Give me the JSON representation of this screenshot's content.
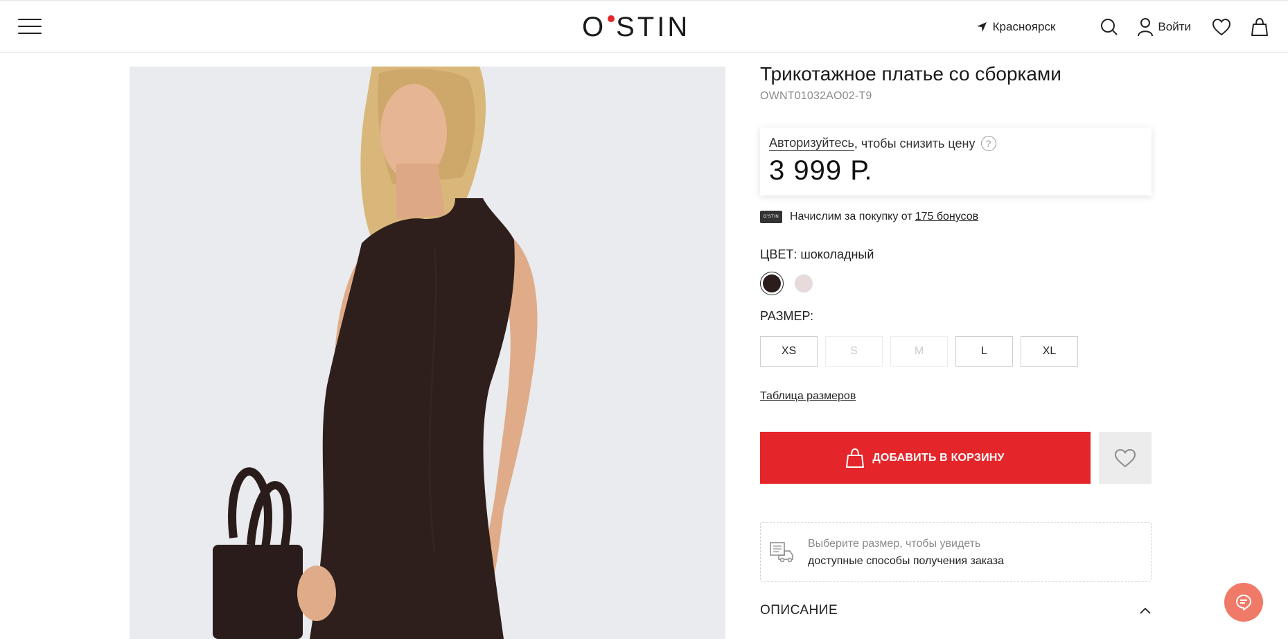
{
  "header": {
    "logo_text": "O'STIN",
    "logo_left": "O",
    "logo_right": "STIN",
    "city": "Красноярск",
    "login": "Войти",
    "icons": [
      "menu-icon",
      "location-arrow-icon",
      "search-icon",
      "user-icon",
      "heart-icon",
      "bag-icon"
    ]
  },
  "product": {
    "title": "Трикотажное платье со сборками",
    "sku": "OWNT01032AO02-T9",
    "price_box": {
      "auth_link": "Авторизуйтесь",
      "auth_suffix": ", чтобы снизить цену",
      "help": "?",
      "price": "3 999 Р."
    },
    "bonus": {
      "badge": "O'STIN",
      "text": "Начислим за покупку от",
      "link": "175 бонусов"
    },
    "color": {
      "label": "ЦВЕТ: шоколадный",
      "swatches": [
        {
          "name": "шоколадный",
          "hex": "#2b1d1c",
          "selected": true
        },
        {
          "name": "светло-розовый",
          "hex": "#e8dadb",
          "selected": false
        }
      ]
    },
    "size": {
      "label": "РАЗМЕР:",
      "options": [
        {
          "label": "XS",
          "available": true
        },
        {
          "label": "S",
          "available": false
        },
        {
          "label": "M",
          "available": false
        },
        {
          "label": "L",
          "available": true
        },
        {
          "label": "XL",
          "available": true
        }
      ],
      "table_link": "Таблица размеров"
    },
    "add_to_cart": "ДОБАВИТЬ В КОРЗИНУ",
    "delivery": {
      "line1": "Выберите размер, чтобы увидеть",
      "line2": "доступные способы получения заказа"
    },
    "description_label": "ОПИСАНИЕ"
  },
  "colors": {
    "accent": "#e4262a",
    "chat": "#f07a68",
    "photo_bg": "#e9ebee",
    "dress": "#2e1f1c"
  }
}
